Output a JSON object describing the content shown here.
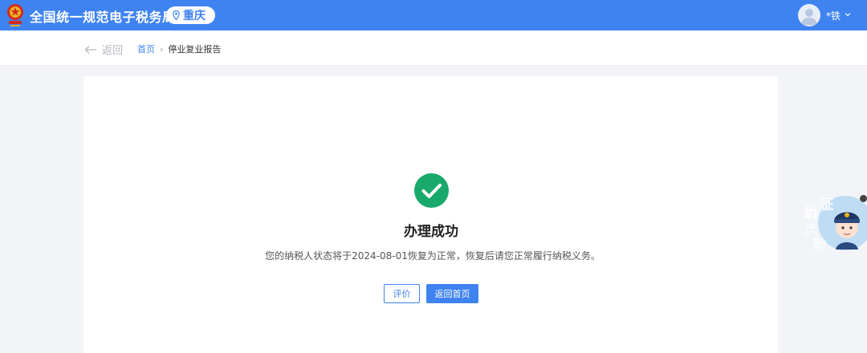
{
  "header": {
    "app_title": "全国统一规范电子税务局",
    "region": "重庆",
    "user_name": "*铁",
    "accent_color": "#3f83f0",
    "icons": [
      "national-emblem-icon",
      "location-pin-icon",
      "user-avatar-icon",
      "chevron-down-icon"
    ]
  },
  "subnav": {
    "back_label": "返回",
    "breadcrumb": {
      "home": "首页",
      "separator": "›",
      "current": "停业复业报告"
    }
  },
  "result": {
    "status_icon": "check-circle-icon",
    "status_color": "#19a96b",
    "title": "办理成功",
    "message": "您的纳税人状态将于2024-08-01恢复为正常，恢复后请您正常履行纳税义务。"
  },
  "actions": {
    "rate_label": "评价",
    "home_label": "返回首页"
  },
  "float_widget": {
    "chars": [
      "征",
      "纳",
      "互",
      "动"
    ]
  }
}
